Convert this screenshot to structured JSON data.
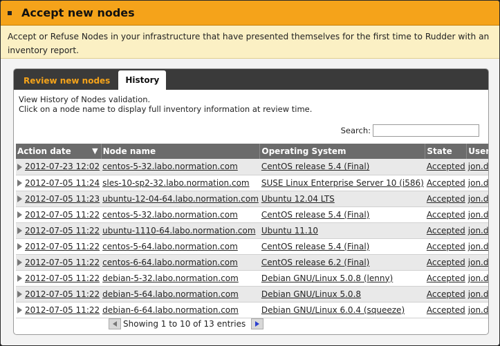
{
  "header": {
    "title": "Accept new nodes"
  },
  "intro": {
    "text": "Accept or Refuse Nodes in your infrastructure that have presented themselves for the first time to Rudder with an inventory report."
  },
  "tabs": [
    {
      "label": "Review new nodes",
      "active": false
    },
    {
      "label": "History",
      "active": true
    }
  ],
  "history": {
    "desc_line1": "View History of Nodes validation.",
    "desc_line2": "Click on a node name to display full inventory information at review time.",
    "search_label": "Search:",
    "search_value": "",
    "columns": [
      "Action date",
      "Node name",
      "Operating System",
      "State",
      "User"
    ],
    "sort_icon": "sort-desc-icon",
    "rows": [
      {
        "date": "2012-07-23 12:02",
        "node": "centos-5-32.labo.normation.com",
        "os": "CentOS release 5.4 (Final)",
        "state": "Accepted",
        "user": "jon.doe"
      },
      {
        "date": "2012-07-05 11:24",
        "node": "sles-10-sp2-32.labo.normation.com",
        "os": "SUSE Linux Enterprise Server 10 (i586)",
        "state": "Accepted",
        "user": "jon.doe"
      },
      {
        "date": "2012-07-05 11:23",
        "node": "ubuntu-12-04-64.labo.normation.com",
        "os": "Ubuntu 12.04 LTS",
        "state": "Accepted",
        "user": "jon.doe"
      },
      {
        "date": "2012-07-05 11:22",
        "node": "centos-5-32.labo.normation.com",
        "os": "CentOS release 5.4 (Final)",
        "state": "Accepted",
        "user": "jon.doe"
      },
      {
        "date": "2012-07-05 11:22",
        "node": "ubuntu-1110-64.labo.normation.com",
        "os": "Ubuntu 11.10",
        "state": "Accepted",
        "user": "jon.doe"
      },
      {
        "date": "2012-07-05 11:22",
        "node": "centos-5-64.labo.normation.com",
        "os": "CentOS release 5.4 (Final)",
        "state": "Accepted",
        "user": "jon.doe"
      },
      {
        "date": "2012-07-05 11:22",
        "node": "centos-6-64.labo.normation.com",
        "os": "CentOS release 6.2 (Final)",
        "state": "Accepted",
        "user": "jon.doe"
      },
      {
        "date": "2012-07-05 11:22",
        "node": "debian-5-32.labo.normation.com",
        "os": "Debian GNU/Linux 5.0.8 (lenny)",
        "state": "Accepted",
        "user": "jon.doe"
      },
      {
        "date": "2012-07-05 11:22",
        "node": "debian-5-64.labo.normation.com",
        "os": "Debian GNU/Linux 5.0.8",
        "state": "Accepted",
        "user": "jon.doe"
      },
      {
        "date": "2012-07-05 11:22",
        "node": "debian-6-64.labo.normation.com",
        "os": "Debian GNU/Linux 6.0.4 (squeeze)",
        "state": "Accepted",
        "user": "jon.doe"
      }
    ],
    "pager_info": "Showing 1 to 10 of 13 entries"
  }
}
